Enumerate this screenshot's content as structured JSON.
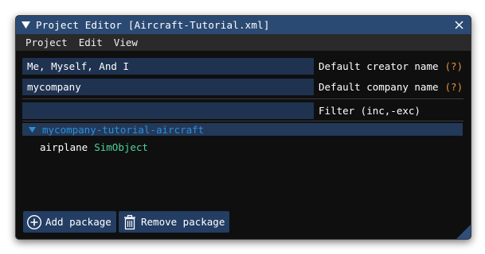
{
  "window": {
    "title": "Project Editor [Aircraft-Tutorial.xml]"
  },
  "menu": {
    "items": [
      "Project",
      "Edit",
      "View"
    ]
  },
  "fields": {
    "creator": {
      "value": "Me, Myself, And I",
      "label": "Default creator name",
      "help": "(?)"
    },
    "company": {
      "value": "mycompany",
      "label": "Default company name",
      "help": "(?)"
    },
    "filter": {
      "value": "",
      "label": "Filter (inc,-exc)"
    }
  },
  "tree": {
    "package": "mycompany-tutorial-aircraft",
    "child_name": "airplane",
    "child_type": "SimObject"
  },
  "buttons": {
    "add": "Add package",
    "remove": "Remove package"
  },
  "colors": {
    "title_bar": "#2b4a73",
    "field_bg": "#1f3250",
    "help": "#e8923a",
    "tree_header_text": "#2f8fd6",
    "simobject": "#4fd39a"
  }
}
